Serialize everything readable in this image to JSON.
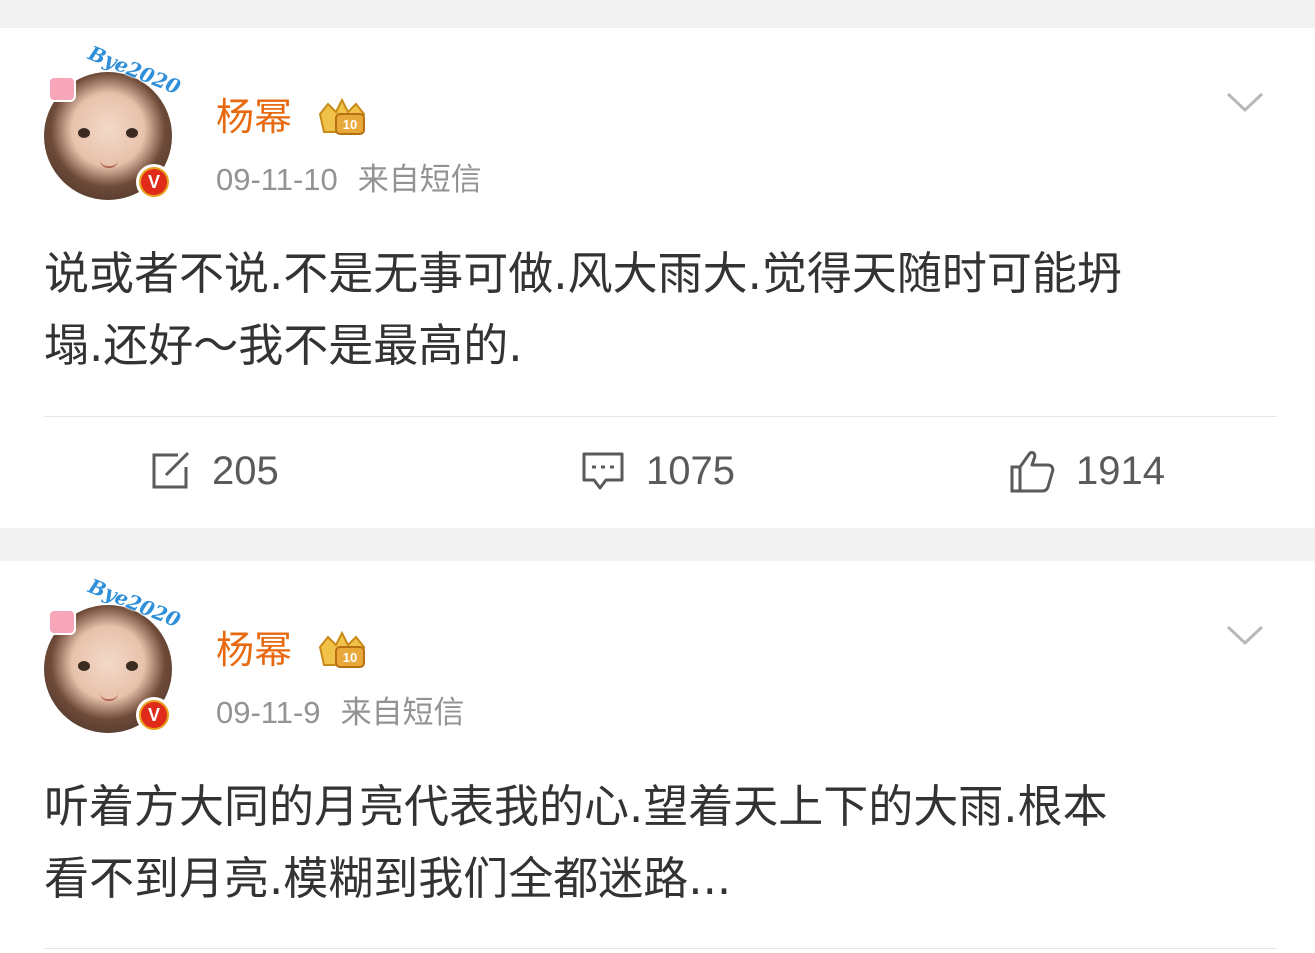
{
  "posts": [
    {
      "username": "杨幂",
      "avatar_decoration": "Bye2020",
      "verified_badge": "V",
      "member_icon": "vip-crown-icon",
      "member_level": "10",
      "date": "09-11-10",
      "source": "来自短信",
      "content_lines": [
        "说或者不说.不是无事可做.风大雨大.觉得天随时可能坍",
        "塌.还好～我不是最高的."
      ],
      "reposts": "205",
      "comments": "1075",
      "likes": "1914"
    },
    {
      "username": "杨幂",
      "avatar_decoration": "Bye2020",
      "verified_badge": "V",
      "member_icon": "vip-crown-icon",
      "member_level": "10",
      "date": "09-11-9",
      "source": "来自短信",
      "content_lines": [
        "听着方大同的月亮代表我的心.望着天上下的大雨.根本",
        "看不到月亮.模糊到我们全都迷路..."
      ]
    }
  ],
  "colors": {
    "username": "#e86a10",
    "meta": "#939393",
    "content": "#333333",
    "action": "#5a5a5a",
    "background": "#f2f2f2",
    "verified": "#e02a1a"
  }
}
